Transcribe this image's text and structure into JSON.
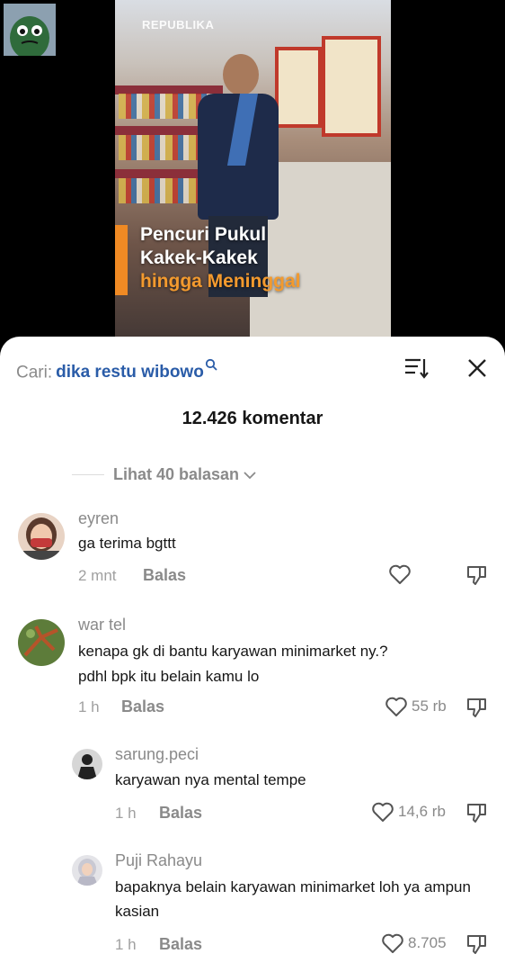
{
  "video": {
    "watermark": "REPUBLIKA",
    "caption_lines": [
      "Pencuri Pukul",
      "Kakek-Kakek",
      "hingga Meninggal"
    ]
  },
  "comments_panel": {
    "search_prefix": "Cari:",
    "search_query": "dika restu wibowo",
    "comment_count": "12.426 komentar",
    "view_replies": "Lihat 40 balasan"
  },
  "comments": [
    {
      "username": "eyren",
      "text": "ga terima bgttt",
      "time": "2 mnt",
      "reply_label": "Balas",
      "likes": ""
    },
    {
      "username": "war tel",
      "text": "kenapa gk di bantu karyawan minimarket ny.?\npdhl bpk itu belain kamu lo",
      "text_line1": "kenapa gk di bantu karyawan minimarket ny.?",
      "text_line2": "pdhl bpk itu belain kamu lo",
      "time": "1 h",
      "reply_label": "Balas",
      "likes": "55 rb"
    }
  ],
  "replies": [
    {
      "username": "sarung.peci",
      "text": "karyawan nya mental tempe",
      "time": "1 h",
      "reply_label": "Balas",
      "likes": "14,6 rb"
    },
    {
      "username": "Puji Rahayu",
      "text_line1": "bapaknya belain karyawan minimarket loh ya ampun",
      "text_line2": "kasian",
      "time": "1 h",
      "reply_label": "Balas",
      "likes": "8.705"
    }
  ],
  "icons": {
    "search": "search-icon",
    "sort": "sort-icon",
    "close": "close-icon",
    "chevron": "chevron-down-icon",
    "like": "heart-icon",
    "dislike": "thumbs-down-icon"
  },
  "colors": {
    "query": "#2a5ca8",
    "caption_accent": "#f08a24",
    "muted": "#8a8a8a"
  }
}
